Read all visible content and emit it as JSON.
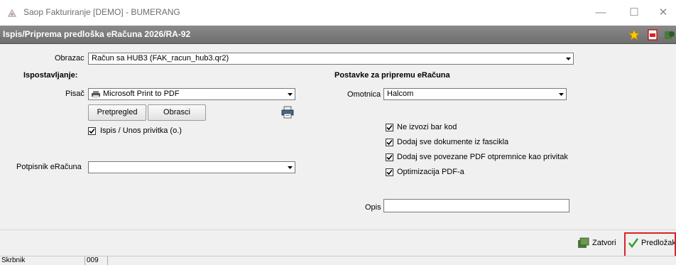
{
  "window": {
    "title": "Saop Fakturiranje [DEMO] - BUMERANG",
    "controls": {
      "minimize": "—",
      "maximize": "☐",
      "close": "✕"
    }
  },
  "form": {
    "title": "Ispis/Priprema predloška eRačuna 2026/RA-92",
    "icons": [
      "star-icon",
      "pdf-icon",
      "exit-icon"
    ]
  },
  "obrazac": {
    "label": "Obrazac",
    "value": "Račun sa HUB3  (FAK_racun_hub3.qr2)"
  },
  "ispostavljanje": {
    "heading": "Ispostavljanje:",
    "pisac": {
      "label": "Pisač",
      "value": "Microsoft Print to PDF"
    },
    "preview_button": "Pretpregled",
    "templates_button": "Obrasci",
    "attachment_checkbox": {
      "label": "Ispis / Unos privitka (o.)",
      "checked": true
    }
  },
  "potpisnik": {
    "label": "Potpisnik eRačuna",
    "value": ""
  },
  "postavke": {
    "heading": "Postavke za pripremu eRačuna",
    "omotnica": {
      "label": "Omotnica",
      "value": "Halcom"
    },
    "options": [
      {
        "label": "Ne izvozi bar kod",
        "checked": true
      },
      {
        "label": "Dodaj sve dokumente iz fascikla",
        "checked": true
      },
      {
        "label": "Dodaj sve povezane PDF otpremnice kao privitak",
        "checked": true
      },
      {
        "label": "Optimizacija PDF-a",
        "checked": true
      }
    ],
    "opis": {
      "label": "Opis",
      "value": ""
    }
  },
  "footer": {
    "close_button": "Zatvori",
    "template_button": "Predložak"
  },
  "status": {
    "user": "Skrbnik",
    "code": "009"
  },
  "colors": {
    "subtitle_bar": "#7a7a7a",
    "highlight": "#d9232a",
    "check_green": "#2a9d2a"
  }
}
